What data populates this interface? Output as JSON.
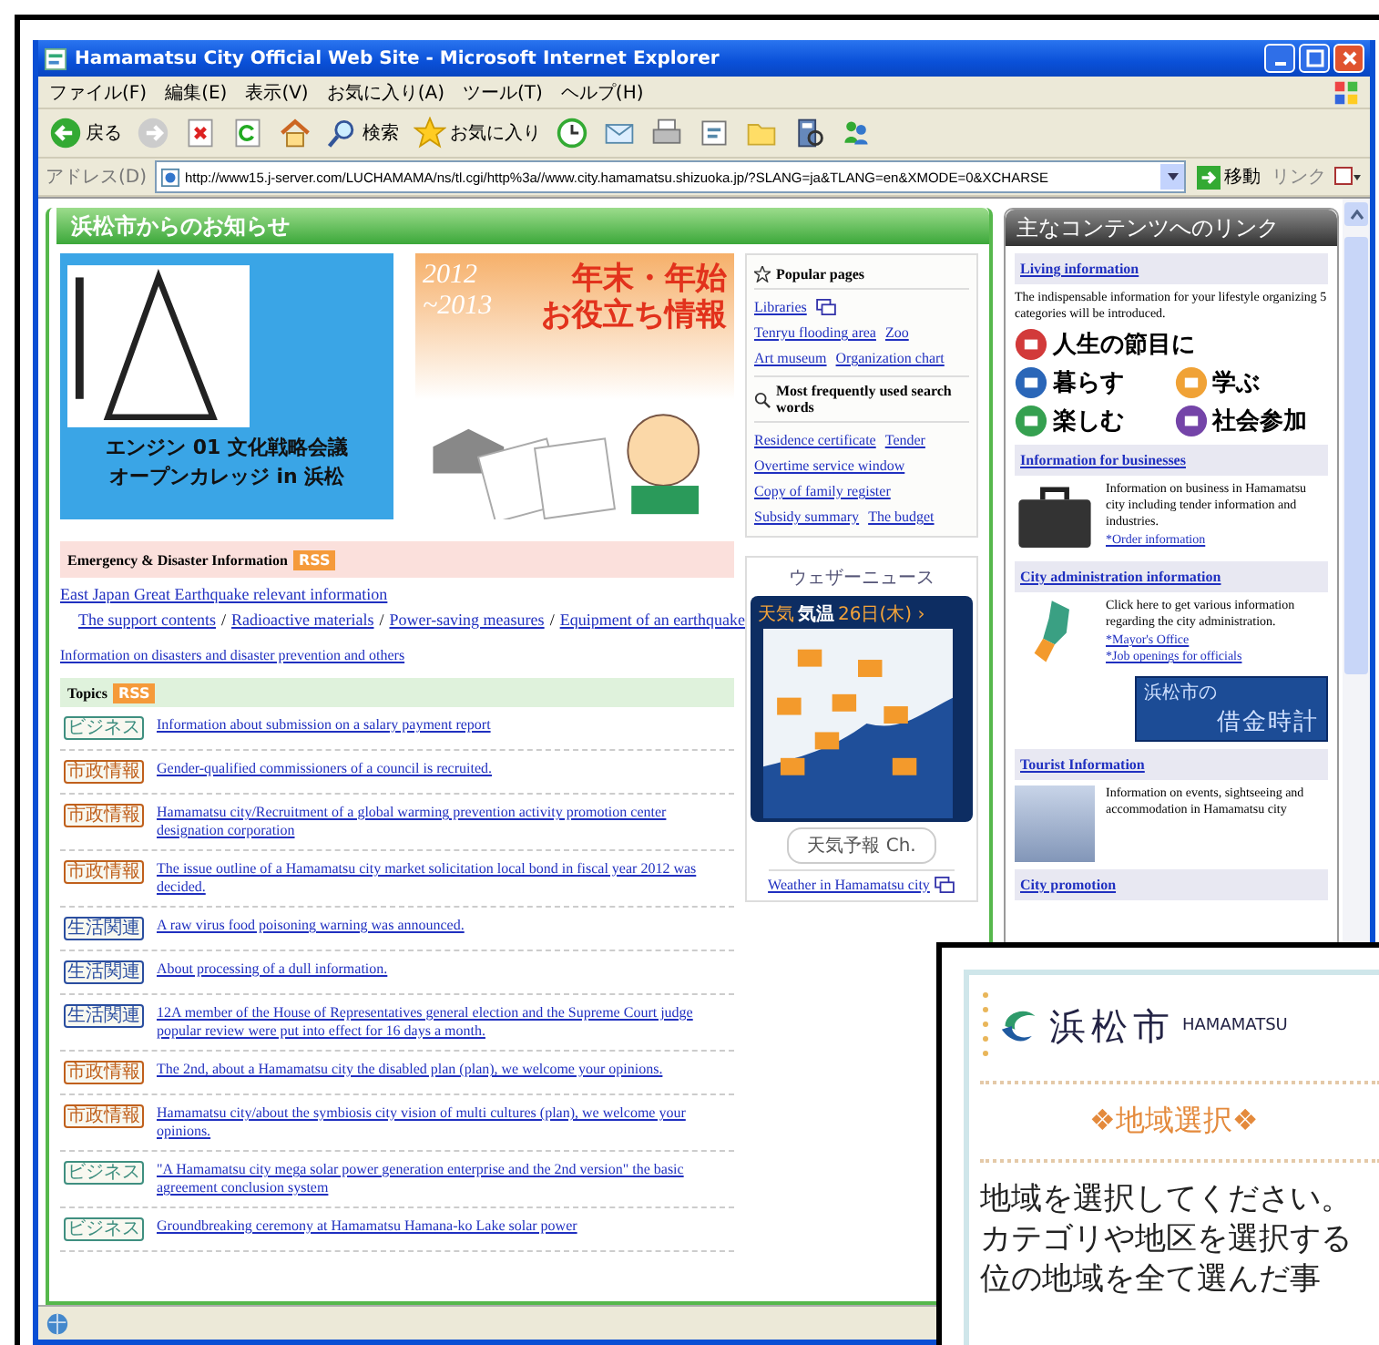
{
  "window": {
    "title": "Hamamatsu City Official Web Site - Microsoft Internet Explorer"
  },
  "menu": [
    "ファイル(F)",
    "編集(E)",
    "表示(V)",
    "お気に入り(A)",
    "ツール(T)",
    "ヘルプ(H)"
  ],
  "toolbar": [
    {
      "kind": "back",
      "label": "戻る"
    },
    {
      "kind": "forward"
    },
    {
      "kind": "stop"
    },
    {
      "kind": "refresh"
    },
    {
      "kind": "home"
    },
    {
      "kind": "search",
      "label": "検索"
    },
    {
      "kind": "favorites",
      "label": "お気に入り"
    },
    {
      "kind": "history"
    },
    {
      "kind": "mail"
    },
    {
      "kind": "print"
    },
    {
      "kind": "edit"
    },
    {
      "kind": "folder"
    },
    {
      "kind": "research"
    },
    {
      "kind": "messenger"
    }
  ],
  "address": {
    "label": "アドレス(D)",
    "url": "http://www15.j-server.com/LUCHAMAMA/ns/tl.cgi/http%3a//www.city.hamamatsu.shizuoka.jp/?SLANG=ja&TLANG=en&XMODE=0&XCHARSE",
    "go": "移動",
    "links": "リンク"
  },
  "notice": {
    "title": "浜松市からのお知らせ",
    "banners": [
      {
        "kind": "engine",
        "lines": [
          "エンジン 01 文化戦略会議",
          "オープンカレッジ in 浜松"
        ]
      },
      {
        "kind": "newyear",
        "years": [
          "2012",
          "~2013"
        ],
        "lines": [
          "年末・年始",
          "お役立ち情報"
        ]
      }
    ]
  },
  "emergency": {
    "title": "Emergency & Disaster Information",
    "rss": "RSS",
    "headline": "East Japan Great Earthquake relevant information",
    "links": [
      "The support contents",
      "Radioactive materials",
      "Power-saving measures",
      "Equipment of an earthquake"
    ],
    "separator": "/",
    "more": "Information on disasters and disaster prevention and others"
  },
  "topics": {
    "title": "Topics",
    "rss": "RSS",
    "items": [
      {
        "tag": "ビジネス",
        "color": "#3f8f80",
        "text": "Information about submission on a salary payment report"
      },
      {
        "tag": "市政情報",
        "color": "#c0601c",
        "text": "Gender-qualified commissioners of a council is recruited."
      },
      {
        "tag": "市政情報",
        "color": "#c0601c",
        "text": "Hamamatsu city/Recruitment of a global warming prevention activity promotion center designation corporation"
      },
      {
        "tag": "市政情報",
        "color": "#c0601c",
        "text": "The issue outline of a Hamamatsu city market solicitation local bond in fiscal year 2012 was decided."
      },
      {
        "tag": "生活関連",
        "color": "#2a4ea0",
        "text": "A raw virus food poisoning warning was announced."
      },
      {
        "tag": "生活関連",
        "color": "#2a4ea0",
        "text": "About processing of a dull information."
      },
      {
        "tag": "生活関連",
        "color": "#2a4ea0",
        "text": "12A member of the House of Representatives general election and the Supreme Court judge popular review were put into effect for 16 days a month."
      },
      {
        "tag": "市政情報",
        "color": "#c0601c",
        "text": "The 2nd, about a Hamamatsu city the disabled plan (plan), we welcome your opinions."
      },
      {
        "tag": "市政情報",
        "color": "#c0601c",
        "text": "Hamamatsu city/about the symbiosis city vision of multi cultures (plan), we welcome your opinions."
      },
      {
        "tag": "ビジネス",
        "color": "#3f8f80",
        "text": "\"A Hamamatsu city mega solar power generation enterprise and the 2nd version\" the basic agreement conclusion system"
      },
      {
        "tag": "ビジネス",
        "color": "#3f8f80",
        "text": "Groundbreaking ceremony at Hamamatsu Hamana-ko Lake solar power"
      }
    ]
  },
  "popular": {
    "title": "Popular pages",
    "rows": [
      [
        {
          "text": "Libraries",
          "external": true
        }
      ],
      [
        {
          "text": "Tenryu flooding area",
          "external": false
        },
        {
          "text": "Zoo",
          "external": false
        }
      ],
      [
        {
          "text": "Art museum",
          "external": false
        },
        {
          "text": "Organization chart",
          "external": false
        }
      ]
    ],
    "search_title": "Most frequently used search words",
    "search_rows": [
      [
        "Residence certificate",
        "Tender"
      ],
      [
        "Overtime service window"
      ],
      [
        "Copy of family register"
      ],
      [
        "Subsidy summary",
        "The budget"
      ]
    ]
  },
  "weather": {
    "brand": "ウェザーニュース",
    "tabs": [
      {
        "label": "天気",
        "selected": false
      },
      {
        "label": "気温",
        "selected": true
      },
      {
        "label": "26日(木) ›",
        "selected": false
      }
    ],
    "button": "天気予報 Ch.",
    "link": "Weather in Hamamatsu city"
  },
  "links_panel": {
    "title": "主なコンテンツへのリンク",
    "sections": [
      {
        "kind": "categories",
        "title": "Living information",
        "description": "The indispensable information for your lifestyle organizing 5 categories will be introduced.",
        "categories": [
          {
            "label": "人生の節目に",
            "color": "#d23a3a"
          },
          {
            "label": "暮らす",
            "color": "#2a66b8"
          },
          {
            "label": "学ぶ",
            "color": "#f0a236"
          },
          {
            "label": "楽しむ",
            "color": "#35a050"
          },
          {
            "label": "社会参加",
            "color": "#7444a8"
          }
        ]
      },
      {
        "kind": "briefcase",
        "title": "Information for businesses",
        "description": "Information on business in Hamamatsu city including tender information and industries.",
        "links": [
          "*Order information"
        ]
      },
      {
        "kind": "map",
        "title": "City administration information",
        "description": "Click here to get various information regarding the city administration.",
        "links": [
          "*Mayor's Office",
          "*Job openings for officials"
        ],
        "banner": [
          "浜松市の",
          "借金時計"
        ]
      },
      {
        "kind": "photo",
        "title": "Tourist Information",
        "description": "Information on events, sightseeing and accommodation in Hamamatsu city"
      },
      {
        "kind": "plain",
        "title": "City promotion"
      }
    ]
  },
  "overlay": {
    "city": "浜松市",
    "city_en": "HAMAMATSU",
    "heading": "❖地域選択❖",
    "lines": [
      "地域を選択してください。",
      "カテゴリや地区を選択する",
      "位の地域を全て選んだ事"
    ]
  }
}
